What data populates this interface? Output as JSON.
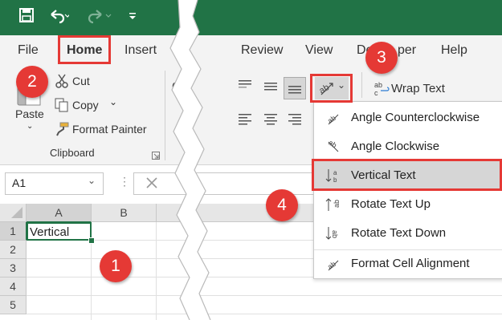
{
  "title_bar": {
    "save_icon": "save-icon",
    "undo_icon": "undo-icon",
    "redo_icon": "redo-icon",
    "customize_icon": "customize-qat-icon"
  },
  "tabs": {
    "file": "File",
    "home": "Home",
    "insert": "Insert",
    "review": "Review",
    "view": "View",
    "developer_partial": "De",
    "developer_partial2": "per",
    "help": "Help"
  },
  "clipboard": {
    "paste": "Paste",
    "cut": "Cut",
    "copy": "Copy",
    "format_painter": "Format Painter",
    "group_label": "Clipboard"
  },
  "alignment": {
    "wrap_text": "Wrap Text"
  },
  "formula_bar": {
    "name_box": "A1"
  },
  "grid": {
    "columns": [
      "A",
      "B"
    ],
    "rows": [
      "1",
      "2",
      "3",
      "4",
      "5"
    ],
    "cell_a1": "Vertical"
  },
  "orientation_menu": {
    "items": [
      {
        "label": "Angle Counterclockwise",
        "icon": "angle-counterclockwise-icon"
      },
      {
        "label": "Angle Clockwise",
        "icon": "angle-clockwise-icon"
      },
      {
        "label": "Vertical Text",
        "icon": "vertical-text-icon"
      },
      {
        "label": "Rotate Text Up",
        "icon": "rotate-text-up-icon"
      },
      {
        "label": "Rotate Text Down",
        "icon": "rotate-text-down-icon"
      },
      {
        "label": "Format Cell Alignment",
        "icon": "format-cell-alignment-icon"
      }
    ]
  },
  "step_badges": {
    "one": "1",
    "two": "2",
    "three": "3",
    "four": "4"
  },
  "colors": {
    "excel_green": "#217346",
    "highlight_red": "#e53935",
    "selected_item_bg": "#d6d6d6"
  }
}
